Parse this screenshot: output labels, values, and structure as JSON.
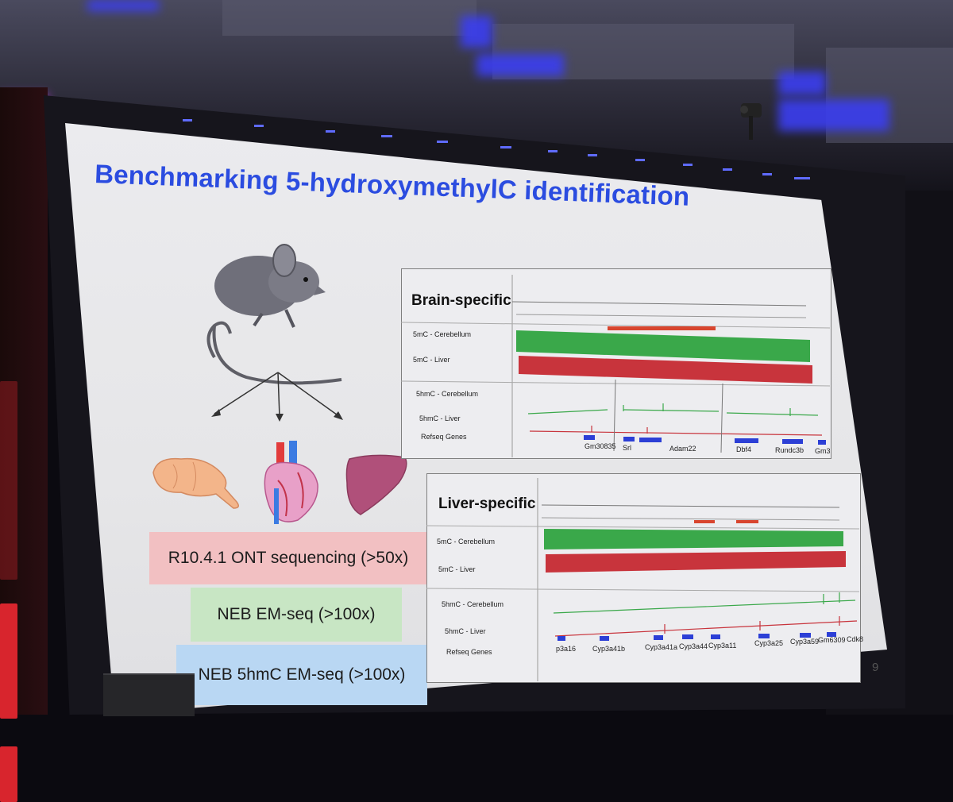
{
  "slide": {
    "title": "Benchmarking 5-hydroxymethylC identification",
    "page_number": "9",
    "methods": [
      {
        "label": "R10.4.1 ONT sequencing (>50x)",
        "color": "#f2c0c2"
      },
      {
        "label": "NEB EM-seq (>100x)",
        "color": "#c8e6c4"
      },
      {
        "label": "NEB 5hmC EM-seq (>100x)",
        "color": "#b9d7f3"
      }
    ],
    "organs": [
      "brain",
      "heart",
      "liver"
    ],
    "panels": [
      {
        "title": "Brain-specific",
        "tracks": [
          "5mC - Cerebellum",
          "5mC - Liver",
          "5hmC - Cerebellum",
          "5hmC - Liver",
          "Refseq Genes"
        ],
        "genes": [
          "Gm30835",
          "Srl",
          "Adam22",
          "Dbf4",
          "Rundc3b",
          "Gm3"
        ]
      },
      {
        "title": "Liver-specific",
        "tracks": [
          "5mC - Cerebellum",
          "5mC - Liver",
          "5hmC - Cerebellum",
          "5hmC - Liver",
          "Refseq Genes"
        ],
        "genes": [
          "p3a16",
          "Cyp3a41b",
          "Cyp3a41a",
          "Cyp3a44",
          "Cyp3a11",
          "Cyp3a25",
          "Cyp3a59",
          "Gm6309",
          "Cdk8"
        ]
      }
    ],
    "colors": {
      "title": "#2b4ce0",
      "methylation_green": "#3aa84a",
      "methylation_red": "#c8343c",
      "gene_blue": "#2c3fd6"
    }
  }
}
